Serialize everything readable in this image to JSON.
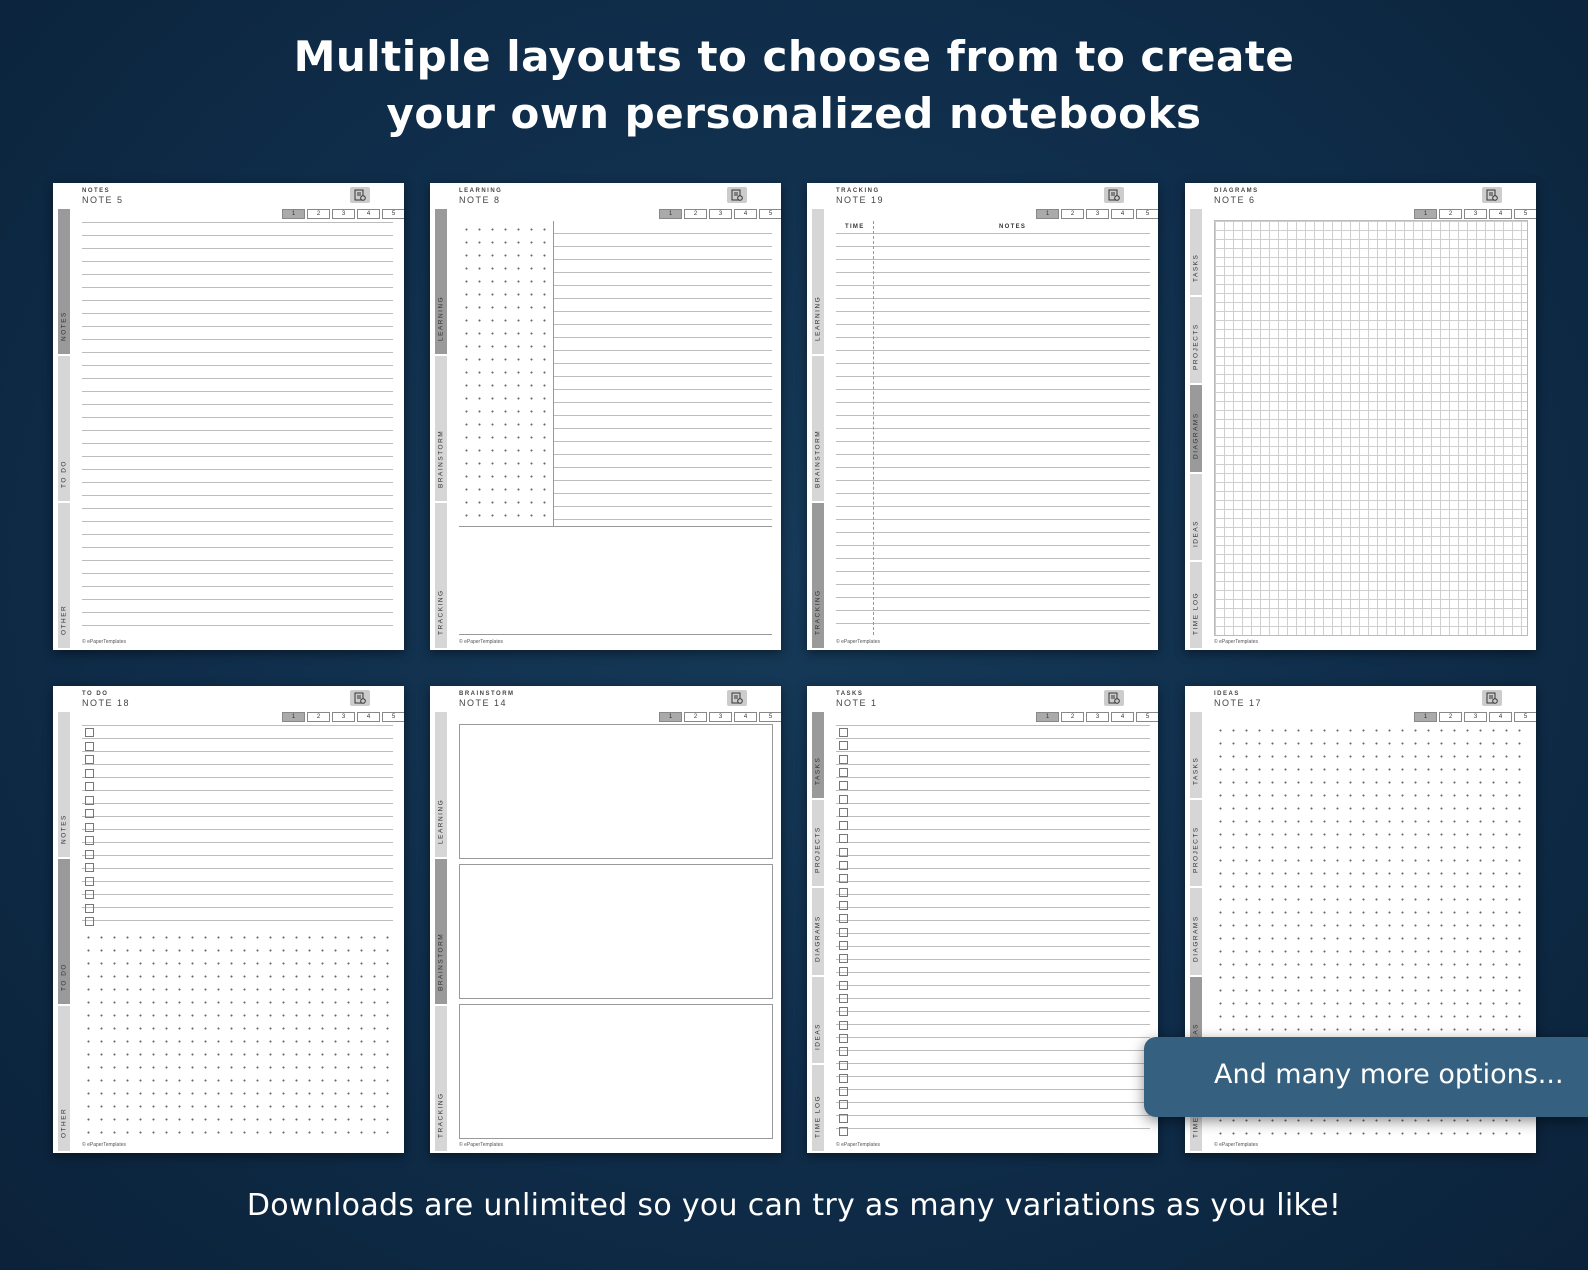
{
  "headline": {
    "line1": "Multiple layouts to choose from to create",
    "line2": "your own personalized notebooks"
  },
  "footer_text": "Downloads are unlimited so you can try as many variations as you like!",
  "callout_text": "And many more options...",
  "page_numbers": [
    "1",
    "2",
    "3",
    "4",
    "5"
  ],
  "copyright": "© ePaperTemplates",
  "cards": [
    {
      "category": "NOTES",
      "title": "NOTE 5",
      "tabs": [
        "NOTES",
        "TO DO",
        "OTHER"
      ],
      "active_tab": 0
    },
    {
      "category": "LEARNING",
      "title": "NOTE 8",
      "tabs": [
        "LEARNING",
        "BRAINSTORM",
        "TRACKING"
      ],
      "active_tab": 0
    },
    {
      "category": "TRACKING",
      "title": "NOTE 19",
      "tabs": [
        "LEARNING",
        "BRAINSTORM",
        "TRACKING"
      ],
      "active_tab": 2,
      "columns": [
        "TIME",
        "NOTES"
      ]
    },
    {
      "category": "DIAGRAMS",
      "title": "NOTE 6",
      "tabs": [
        "TASKS",
        "PROJECTS",
        "DIAGRAMS",
        "IDEAS",
        "TIME LOG"
      ],
      "active_tab": 2
    },
    {
      "category": "TO DO",
      "title": "NOTE 18",
      "tabs": [
        "NOTES",
        "TO DO",
        "OTHER"
      ],
      "active_tab": 1
    },
    {
      "category": "BRAINSTORM",
      "title": "NOTE 14",
      "tabs": [
        "LEARNING",
        "BRAINSTORM",
        "TRACKING"
      ],
      "active_tab": 1
    },
    {
      "category": "TASKS",
      "title": "NOTE 1",
      "tabs": [
        "TASKS",
        "PROJECTS",
        "DIAGRAMS",
        "IDEAS",
        "TIME LOG"
      ],
      "active_tab": 0
    },
    {
      "category": "IDEAS",
      "title": "NOTE 17",
      "tabs": [
        "TASKS",
        "PROJECTS",
        "DIAGRAMS",
        "IDEAS",
        "TIME LOG"
      ],
      "active_tab": 3
    }
  ]
}
